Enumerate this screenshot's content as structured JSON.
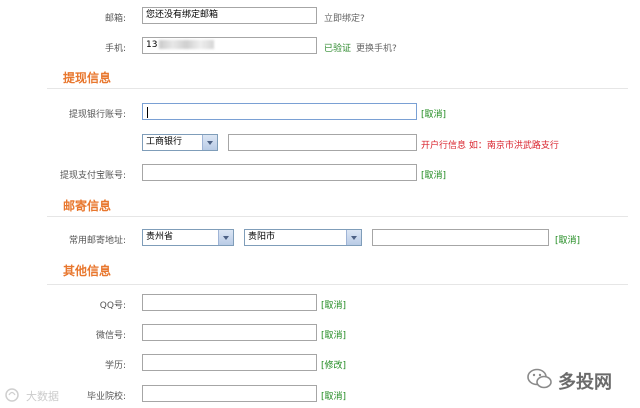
{
  "account": {
    "email_label": "邮箱:",
    "email_value": "您还没有绑定邮箱",
    "email_bind_link": "立即绑定?",
    "phone_label": "手机:",
    "phone_value": "13",
    "phone_verified": "已验证",
    "phone_change_link": "更换手机?"
  },
  "withdraw": {
    "section_title": "提现信息",
    "bank_account_label": "提现银行账号:",
    "bank_account_value": "",
    "cancel": "[取消]",
    "bank_select": "工商银行",
    "branch_value": "",
    "branch_hint": "开户行信息 如：南京市洪武路支行",
    "alipay_label": "提现支付宝账号:",
    "alipay_value": ""
  },
  "mailing": {
    "section_title": "邮寄信息",
    "address_label": "常用邮寄地址:",
    "province_select": "贵州省",
    "city_select": "贵阳市",
    "detail_value": "",
    "cancel": "[取消]"
  },
  "other": {
    "section_title": "其他信息",
    "qq_label": "QQ号:",
    "qq_cancel": "[取消]",
    "wechat_label": "微信号:",
    "wechat_cancel": "[取消]",
    "education_label": "学历:",
    "education_action": "[修改]",
    "school_label": "毕业院校:",
    "school_cancel": "[取消]"
  },
  "watermarks": {
    "left": "大数据",
    "right": "多投网"
  }
}
